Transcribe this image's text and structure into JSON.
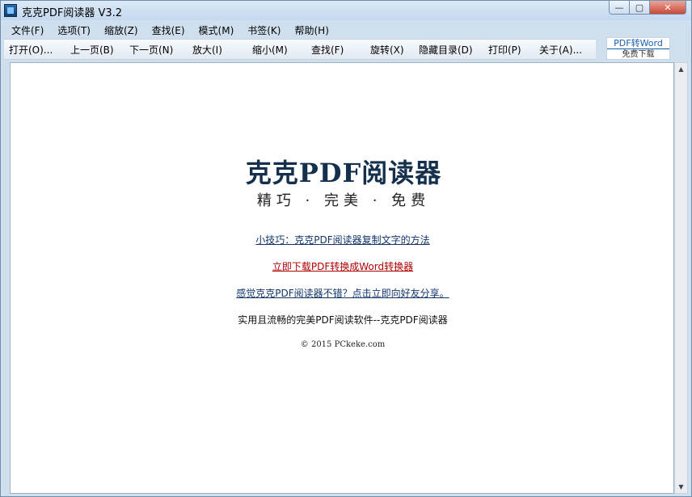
{
  "window": {
    "title": "克克PDF阅读器 V3.2",
    "minimize_glyph": "—",
    "maximize_glyph": "▢",
    "close_glyph": "✕"
  },
  "menu": [
    "文件(F)",
    "选项(T)",
    "缩放(Z)",
    "查找(E)",
    "模式(M)",
    "书签(K)",
    "帮助(H)"
  ],
  "toolbar": {
    "open": "打开(O)...",
    "prev_page": "上一页(B)",
    "next_page": "下一页(N)",
    "zoom_in": "放大(I)",
    "zoom_out": "缩小(M)",
    "find": "查找(F)",
    "rotate": "旋转(X)",
    "toggle_toc": "隐藏目录(D)",
    "print": "打印(P)",
    "about": "关于(A)..."
  },
  "promo": {
    "title": "PDF转Word",
    "subtitle": "免费下载"
  },
  "content": {
    "logo_title": "克克PDF阅读器",
    "logo_tagline": "精巧 · 完美 · 免费",
    "tip_link": "小技巧：克克PDF阅读器复制文字的方法",
    "download_link": "立即下载PDF转换成Word转换器",
    "share_link": "感觉克克PDF阅读器不错？点击立即向好友分享。",
    "slogan": "实用且流畅的完美PDF阅读软件--克克PDF阅读器",
    "copyright": "© 2015 PCkeke.com"
  },
  "colors": {
    "link_blue": "#12356b",
    "link_red": "#b00000",
    "logo": "#15304d"
  }
}
